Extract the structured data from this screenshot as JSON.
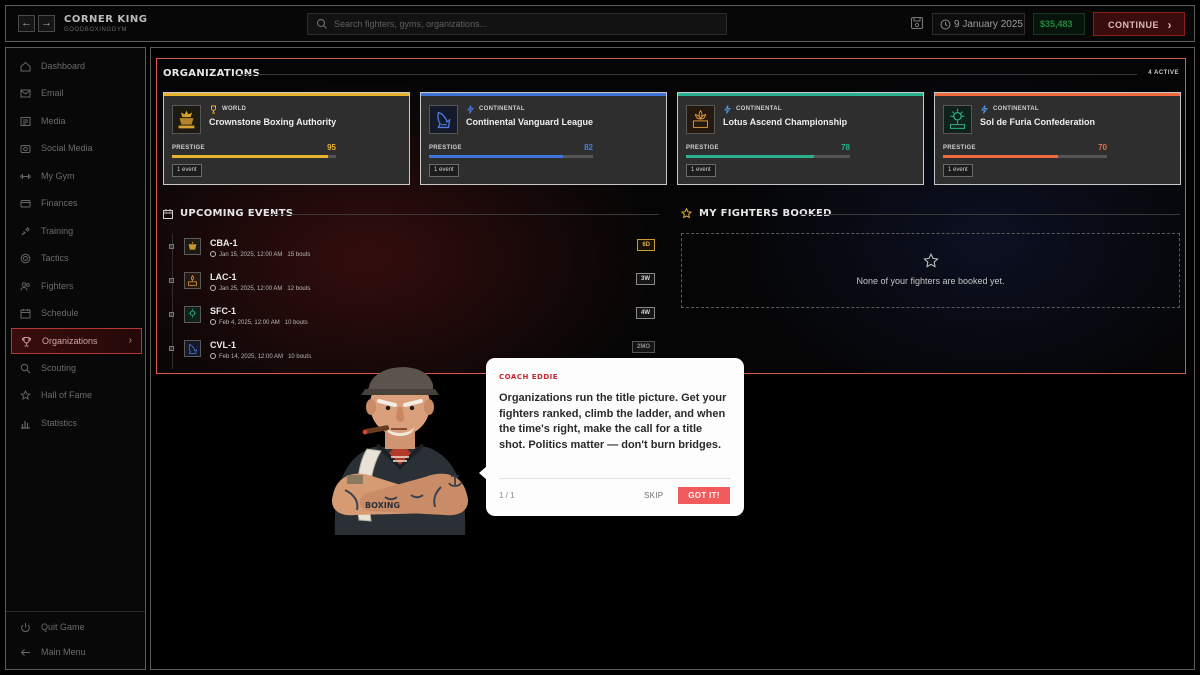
{
  "app": {
    "title": "CORNER KING",
    "subtitle": "GOODBOXINGGYM"
  },
  "header": {
    "search_placeholder": "Search fighters, gyms, organizations...",
    "date": "9 January 2025",
    "money": "$35,483",
    "continue_label": "CONTINUE"
  },
  "sidebar": {
    "items": [
      {
        "label": "Dashboard",
        "icon": "home-icon"
      },
      {
        "label": "Email",
        "icon": "mail-icon"
      },
      {
        "label": "Media",
        "icon": "newspaper-icon"
      },
      {
        "label": "Social Media",
        "icon": "camera-icon"
      },
      {
        "label": "My Gym",
        "icon": "dumbbell-icon"
      },
      {
        "label": "Finances",
        "icon": "card-icon"
      },
      {
        "label": "Training",
        "icon": "training-icon"
      },
      {
        "label": "Tactics",
        "icon": "target-icon"
      },
      {
        "label": "Fighters",
        "icon": "users-icon"
      },
      {
        "label": "Schedule",
        "icon": "calendar-icon"
      },
      {
        "label": "Organizations",
        "icon": "trophy-icon",
        "active": true
      },
      {
        "label": "Scouting",
        "icon": "search-icon"
      },
      {
        "label": "Hall of Fame",
        "icon": "star-icon"
      },
      {
        "label": "Statistics",
        "icon": "chart-icon"
      }
    ],
    "footer": [
      {
        "label": "Quit Game",
        "icon": "power-icon"
      },
      {
        "label": "Main Menu",
        "icon": "back-arrow-icon"
      }
    ]
  },
  "organizations": {
    "title": "ORGANIZATIONS",
    "active_count": "4 ACTIVE",
    "prestige_label": "PRESTIGE",
    "cards": [
      {
        "tier": "WORLD",
        "name": "Crownstone Boxing Authority",
        "abbr": "CBA",
        "prestige": 95,
        "prestige_display": "95",
        "events": "1 event",
        "color": "#e8b32e"
      },
      {
        "tier": "CONTINENTAL",
        "name": "Continental Vanguard League",
        "abbr": "CVL",
        "prestige": 82,
        "prestige_display": "82",
        "events": "1 event",
        "color": "#3f73d8"
      },
      {
        "tier": "CONTINENTAL",
        "name": "Lotus Ascend Championship",
        "abbr": "LAC",
        "prestige": 78,
        "prestige_display": "78",
        "events": "1 event",
        "color": "#28b28f"
      },
      {
        "tier": "CONTINENTAL",
        "name": "Sol de Furia Confederation",
        "abbr": "SFC",
        "prestige": 70,
        "prestige_display": "70",
        "events": "1 event",
        "color": "#ef6a3c"
      }
    ]
  },
  "upcoming_events": {
    "title": "UPCOMING EVENTS",
    "events": [
      {
        "name": "CBA-1",
        "meta": "Jan 15, 2025, 12:00 AM",
        "bouts": "15 bouts",
        "countdown": "6D",
        "style": "hot",
        "color": "#e8b32e"
      },
      {
        "name": "LAC-1",
        "meta": "Jan 25, 2025, 12:00 AM",
        "bouts": "12 bouts",
        "countdown": "3W",
        "style": "normal",
        "color": "#e29a3a"
      },
      {
        "name": "SFC-1",
        "meta": "Feb 4, 2025, 12:00 AM",
        "bouts": "10 bouts",
        "countdown": "4W",
        "style": "normal",
        "color": "#28b28f"
      },
      {
        "name": "CVL-1",
        "meta": "Feb 14, 2025, 12:00 AM",
        "bouts": "10 bouts",
        "countdown": "2MO",
        "style": "dim",
        "color": "#3f73d8"
      }
    ]
  },
  "booked": {
    "title": "MY FIGHTERS BOOKED",
    "empty_message": "None of your fighters are booked yet."
  },
  "coach": {
    "speaker": "COACH EDDIE",
    "message": "Organizations run the title picture. Get your fighters ranked, climb the ladder, and when the time's right, make the call for a title shot. Politics matter — don't burn bridges.",
    "pager": "1 / 1",
    "skip_label": "SKIP",
    "gotit_label": "GOT IT!",
    "shirt_text": "BOXING"
  }
}
